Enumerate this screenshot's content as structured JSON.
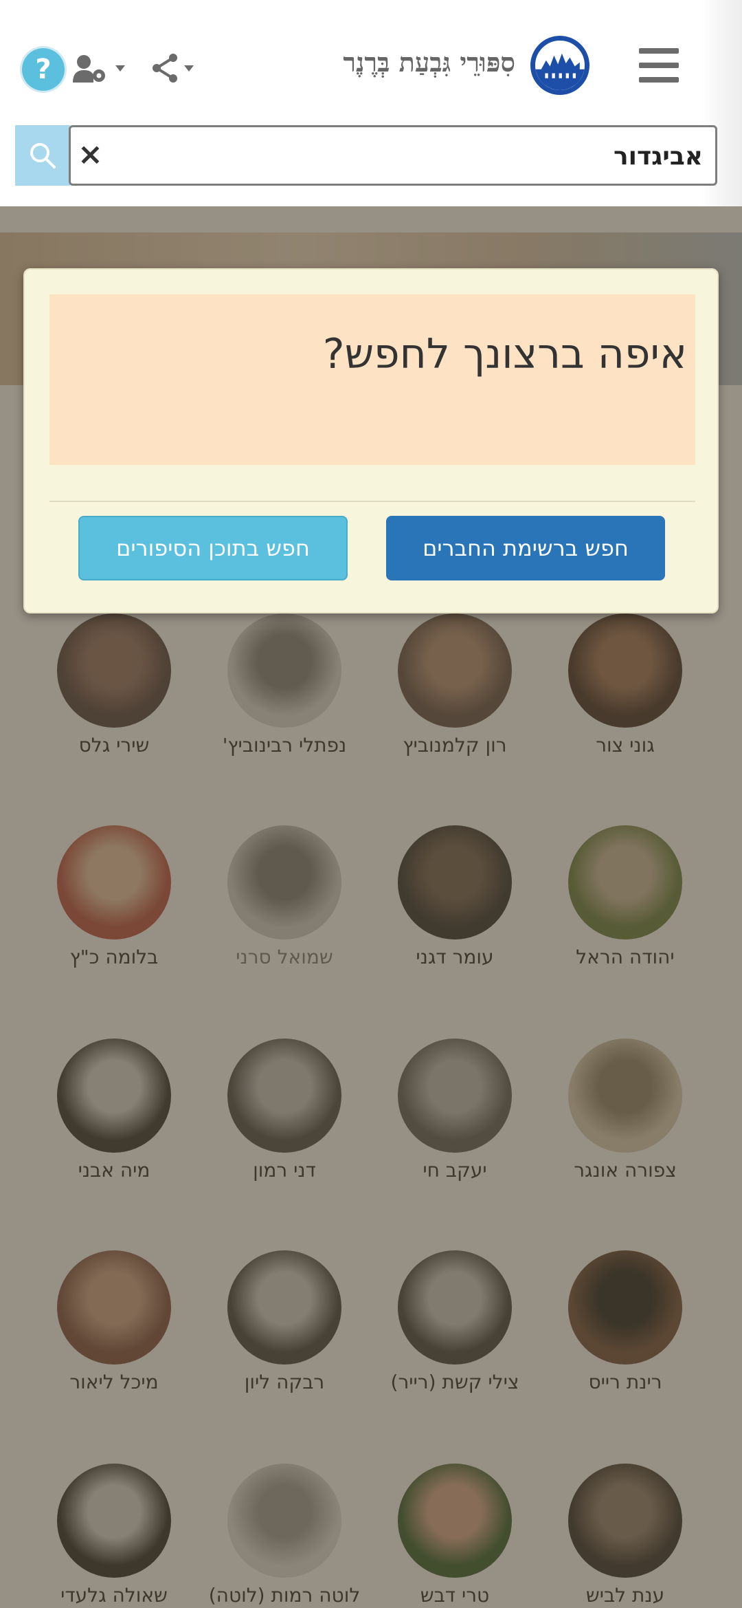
{
  "header": {
    "site_title": "סִפּוּרֵי גִּבְעַת בְּרֶנֶר",
    "help_label": "?"
  },
  "search": {
    "value": "אביגדור",
    "clear_label": "×"
  },
  "modal": {
    "question": "איפה ברצונך לחפש?",
    "members_button": "חפש ברשימת החברים",
    "content_button": "חפש בתוכן הסיפורים"
  },
  "people": [
    {
      "name": "גוני צור"
    },
    {
      "name": "רון קלמנוביץ"
    },
    {
      "name": "נפתלי רבינוביץ'"
    },
    {
      "name": "שירי גלס"
    },
    {
      "name": "יהודה הראל"
    },
    {
      "name": "עומר דגני"
    },
    {
      "name": "שמואל סרני"
    },
    {
      "name": "בלומה כ\"ץ"
    },
    {
      "name": "צפורה אונגר"
    },
    {
      "name": "יעקב חי"
    },
    {
      "name": "דני רמון"
    },
    {
      "name": "מיה אבני"
    },
    {
      "name": "רינת רייס"
    },
    {
      "name": "צילי קשת (רייר)"
    },
    {
      "name": "רבקה ליון"
    },
    {
      "name": "מיכל ליאור"
    },
    {
      "name": "ענת לביש"
    },
    {
      "name": "טרי דבש"
    },
    {
      "name": "לוטה רמות (לוטה)"
    },
    {
      "name": "שאולה גלעדי"
    }
  ],
  "colors": {
    "brand_blue": "#1d4fa8",
    "button_primary": "#2a75b8",
    "button_info": "#5bc0de",
    "modal_bg": "#f7f5dc",
    "modal_panel": "#fde3c3"
  }
}
